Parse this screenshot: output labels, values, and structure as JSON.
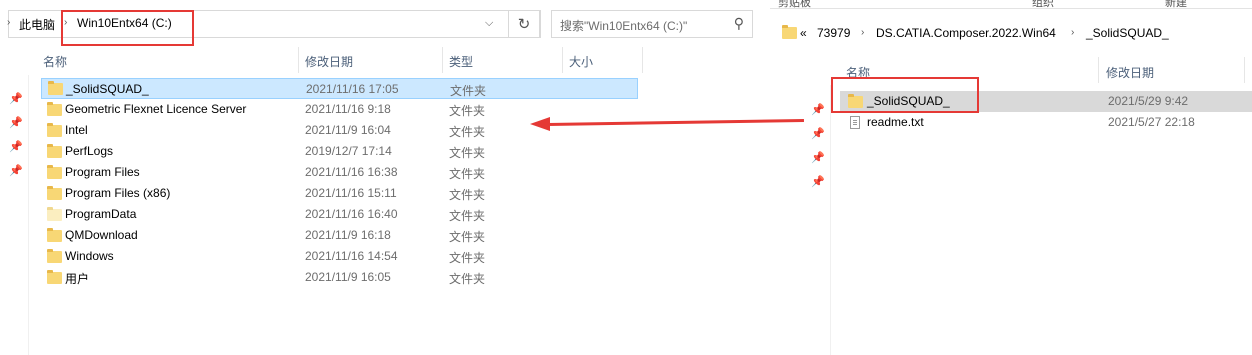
{
  "left": {
    "breadcrumb": [
      "此电脑",
      "Win10Entx64 (C:)"
    ],
    "search_placeholder": "搜索\"Win10Entx64 (C:)\"",
    "columns": [
      "名称",
      "修改日期",
      "类型",
      "大小"
    ],
    "rows": [
      {
        "name": "_SolidSQUAD_",
        "date": "2021/11/16 17:05",
        "type": "文件夹",
        "icon": "folder-icon",
        "selected": true
      },
      {
        "name": "Geometric Flexnet Licence Server",
        "date": "2021/11/16 9:18",
        "type": "文件夹",
        "icon": "folder-icon"
      },
      {
        "name": "Intel",
        "date": "2021/11/9 16:04",
        "type": "文件夹",
        "icon": "folder-icon"
      },
      {
        "name": "PerfLogs",
        "date": "2019/12/7 17:14",
        "type": "文件夹",
        "icon": "folder-icon"
      },
      {
        "name": "Program Files",
        "date": "2021/11/16 16:38",
        "type": "文件夹",
        "icon": "folder-icon"
      },
      {
        "name": "Program Files (x86)",
        "date": "2021/11/16 15:11",
        "type": "文件夹",
        "icon": "folder-icon"
      },
      {
        "name": "ProgramData",
        "date": "2021/11/16 16:40",
        "type": "文件夹",
        "icon": "folder-icon"
      },
      {
        "name": "QMDownload",
        "date": "2021/11/9 16:18",
        "type": "文件夹",
        "icon": "folder-icon"
      },
      {
        "name": "Windows",
        "date": "2021/11/16 14:54",
        "type": "文件夹",
        "icon": "folder-icon"
      },
      {
        "name": "用户",
        "date": "2021/11/9 16:05",
        "type": "文件夹",
        "icon": "folder-icon"
      }
    ]
  },
  "right": {
    "ribbon": [
      "剪贴板",
      "组织",
      "新建"
    ],
    "breadcrumb": [
      "«",
      "73979",
      "DS.CATIA.Composer.2022.Win64",
      "_SolidSQUAD_"
    ],
    "columns": [
      "名称",
      "修改日期"
    ],
    "rows": [
      {
        "name": "_SolidSQUAD_",
        "date": "2021/5/29 9:42",
        "icon": "folder-icon",
        "selected": true
      },
      {
        "name": "readme.txt",
        "date": "2021/5/27 22:18",
        "icon": "text-file-icon"
      }
    ]
  },
  "colors": {
    "annotation_red": "#e53935",
    "selection_blue": "#cce8ff",
    "folder_yellow": "#f8d775"
  }
}
